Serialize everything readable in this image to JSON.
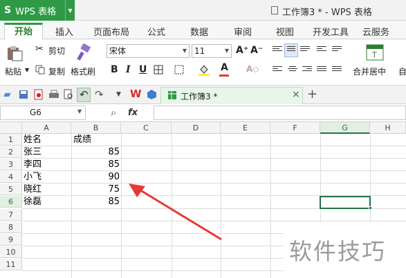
{
  "app": {
    "name": "WPS 表格",
    "logo_glyph": "S",
    "doc_title": "工作簿3 * - WPS 表格",
    "accent": "#2e9a45"
  },
  "tabs": [
    "开始",
    "插入",
    "页面布局",
    "公式",
    "数据",
    "审阅",
    "视图",
    "开发工具",
    "云服务"
  ],
  "ribbon": {
    "paste": "粘贴",
    "cut": "剪切",
    "copy": "复制",
    "format_painter": "格式刷",
    "font": "宋体",
    "size": "11",
    "grow": "A⁺",
    "shrink": "A⁻",
    "bold": "B",
    "italic": "I",
    "underline": "U",
    "merge_center": "合并居中",
    "auto": "自"
  },
  "quickbar": {
    "doc_tab": "工作簿3 *",
    "close": "×",
    "new": "+"
  },
  "formula_bar": {
    "name_box": "G6",
    "fx": "fx",
    "value": ""
  },
  "columns": [
    "A",
    "B",
    "C",
    "D",
    "E",
    "F",
    "G",
    "H"
  ],
  "rows": [
    "1",
    "2",
    "3",
    "4",
    "5",
    "6",
    "7",
    "8",
    "9",
    "10",
    "11"
  ],
  "sheet": {
    "header": {
      "name": "姓名",
      "score": "成绩"
    },
    "records": [
      {
        "name": "张三",
        "score": "85"
      },
      {
        "name": "李四",
        "score": "85"
      },
      {
        "name": "小飞",
        "score": "90"
      },
      {
        "name": "晓红",
        "score": "75"
      },
      {
        "name": "徐磊",
        "score": "85"
      }
    ]
  },
  "watermark": "软件技巧",
  "colors": {
    "arrow": "#e53935",
    "selection": "#217346"
  }
}
